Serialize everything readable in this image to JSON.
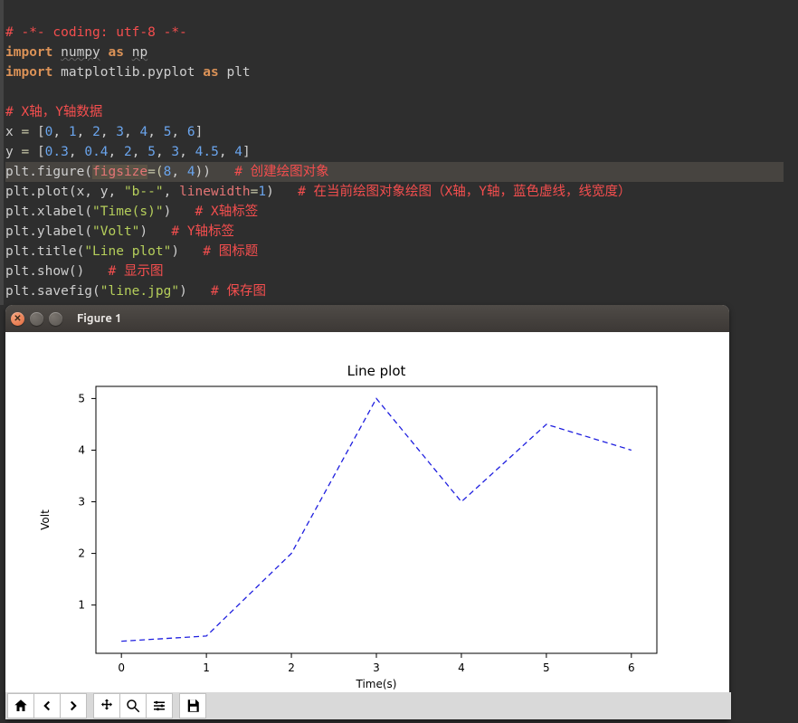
{
  "code": {
    "l1_comment": "# -*- coding: utf-8 -*-",
    "l2_import": "import",
    "l2_mod": "numpy",
    "l2_as": "as",
    "l2_alias": "np",
    "l3_import": "import",
    "l3_mod": "matplotlib.pyplot",
    "l3_as": "as",
    "l3_alias": "plt",
    "l5_comment": "# X轴，Y轴数据",
    "l6_var": "x",
    "l6_eq": "=",
    "l6_list": "[0, 1, 2, 3, 4, 5, 6]",
    "l7_var": "y",
    "l7_eq": "=",
    "l7_list": "[0.3, 0.4, 2, 5, 3, 4.5, 4]",
    "l8_call": "plt.figure(",
    "l8_kw": "figsize",
    "l8_rest": "=(8, 4))",
    "l8_comment": "# 创建绘图对象",
    "l9_call": "plt.plot(x, y, ",
    "l9_str": "\"b--\"",
    "l9_comma": ", ",
    "l9_kw": "linewidth",
    "l9_rest": "=1)",
    "l9_comment": "# 在当前绘图对象绘图（X轴，Y轴，蓝色虚线，线宽度）",
    "l10_call": "plt.xlabel(",
    "l10_str": "\"Time(s)\"",
    "l10_close": ")",
    "l10_comment": "# X轴标签",
    "l11_call": "plt.ylabel(",
    "l11_str": "\"Volt\"",
    "l11_close": ")",
    "l11_comment": "# Y轴标签",
    "l12_call": "plt.title(",
    "l12_str": "\"Line plot\"",
    "l12_close": ")",
    "l12_comment": "# 图标题",
    "l13_call": "plt.show()",
    "l13_comment": "# 显示图",
    "l14_call": "plt.savefig(",
    "l14_str": "\"line.jpg\"",
    "l14_close": ")",
    "l14_comment": "# 保存图"
  },
  "figwin": {
    "title": "Figure 1"
  },
  "toolbar": {
    "home": "home-icon",
    "back": "back-icon",
    "forward": "forward-icon",
    "pan": "pan-icon",
    "zoom": "zoom-icon",
    "config": "config-icon",
    "save": "save-icon"
  },
  "chart_data": {
    "type": "line",
    "x": [
      0,
      1,
      2,
      3,
      4,
      5,
      6
    ],
    "values": [
      0.3,
      0.4,
      2,
      5,
      3,
      4.5,
      4
    ],
    "title": "Line plot",
    "xlabel": "Time(s)",
    "ylabel": "Volt",
    "xticks": [
      0,
      1,
      2,
      3,
      4,
      5,
      6
    ],
    "yticks": [
      1,
      2,
      3,
      4,
      5
    ],
    "xrange": [
      -0.3,
      6.3
    ],
    "yrange": [
      0.065,
      5.235
    ],
    "style": "b--",
    "linewidth": 1
  }
}
